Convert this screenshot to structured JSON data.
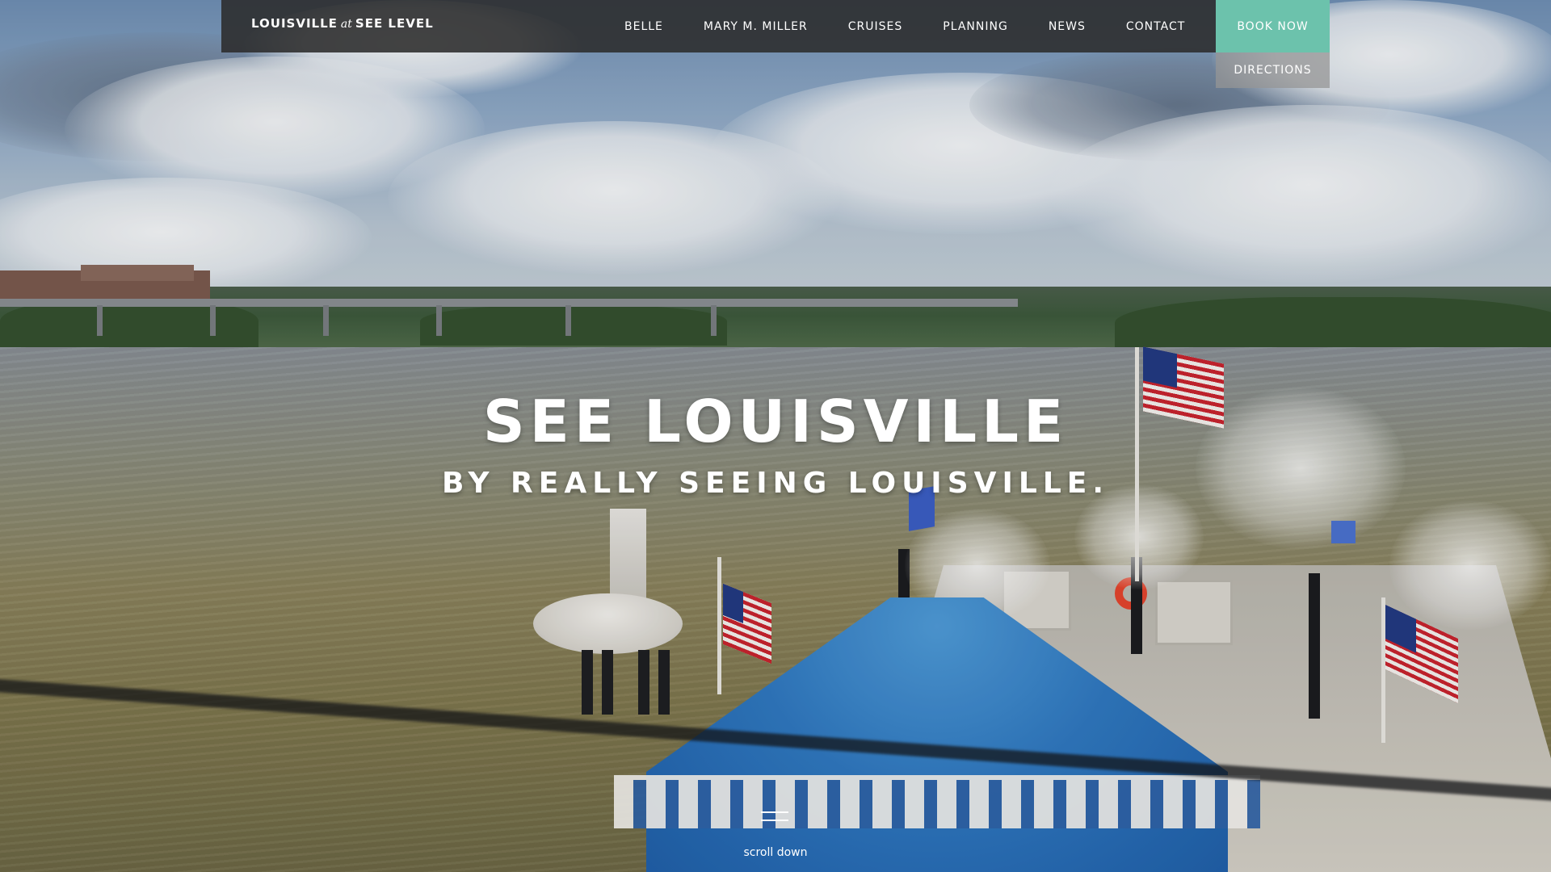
{
  "brand": {
    "part1": "LOUISVILLE",
    "at": "at",
    "part2": "SEE LEVEL"
  },
  "nav": {
    "items": [
      {
        "label": "BELLE"
      },
      {
        "label": "MARY M. MILLER"
      },
      {
        "label": "CRUISES"
      },
      {
        "label": "PLANNING"
      },
      {
        "label": "NEWS"
      },
      {
        "label": "CONTACT"
      }
    ],
    "book_now": "BOOK NOW",
    "directions": "DIRECTIONS"
  },
  "hero": {
    "title": "SEE LOUISVILLE",
    "subtitle": "BY REALLY SEEING LOUISVILLE.",
    "scroll_label": "scroll down",
    "scroll_icon": "scroll-down-lines-icon",
    "image": "riverboat-on-ohio-river-background"
  },
  "colors": {
    "navbar_bg": "#2b2b2b",
    "book_now_bg": "#6cc2ac",
    "directions_bg": "#969696",
    "text": "#ffffff"
  }
}
